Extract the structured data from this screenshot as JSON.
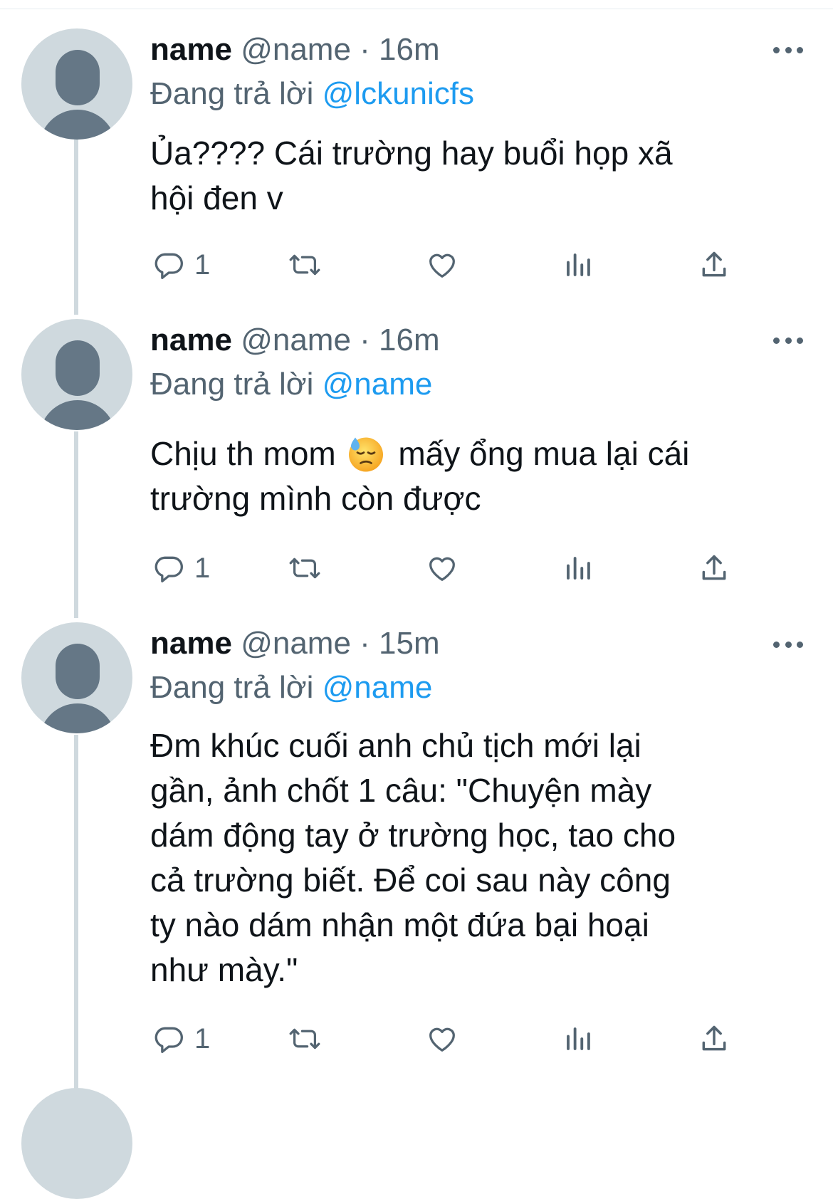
{
  "tweets": [
    {
      "name": "name",
      "handle": "@name",
      "time": "· 16m",
      "replying_prefix": "Đang trả lời",
      "replying_to": "@lckunicfs",
      "text_lines": [
        "Ủa???? Cái trường hay buổi họp xã",
        "hội đen v"
      ],
      "reply_count": "1"
    },
    {
      "name": "name",
      "handle": "@name",
      "time": "· 16m",
      "replying_prefix": "Đang trả lời",
      "replying_to": "@name",
      "text_before_emoji": "Chịu th mom",
      "emoji": "downcast-face-with-sweat",
      "text_after_emoji": "mấy ổng mua lại cái",
      "text_line_2": "trường mình còn được",
      "reply_count": "1"
    },
    {
      "name": "name",
      "handle": "@name",
      "time": "· 15m",
      "replying_prefix": "Đang trả lời",
      "replying_to": "@name",
      "text_lines": [
        "Đm khúc cuối anh chủ tịch mới lại",
        "gần, ảnh chốt 1 câu: \"Chuyện mày",
        "dám động tay ở trường học, tao cho",
        "cả trường biết. Để coi sau này công",
        "ty nào dám nhận một đứa bại hoại",
        "như mày.\""
      ],
      "reply_count": "1"
    }
  ],
  "colors": {
    "text": "#0f1419",
    "secondary": "#536471",
    "link": "#1d9bf0",
    "avatar_bg": "#cfd9de",
    "avatar_fg": "#657786",
    "thread_line": "#cfd9de"
  }
}
